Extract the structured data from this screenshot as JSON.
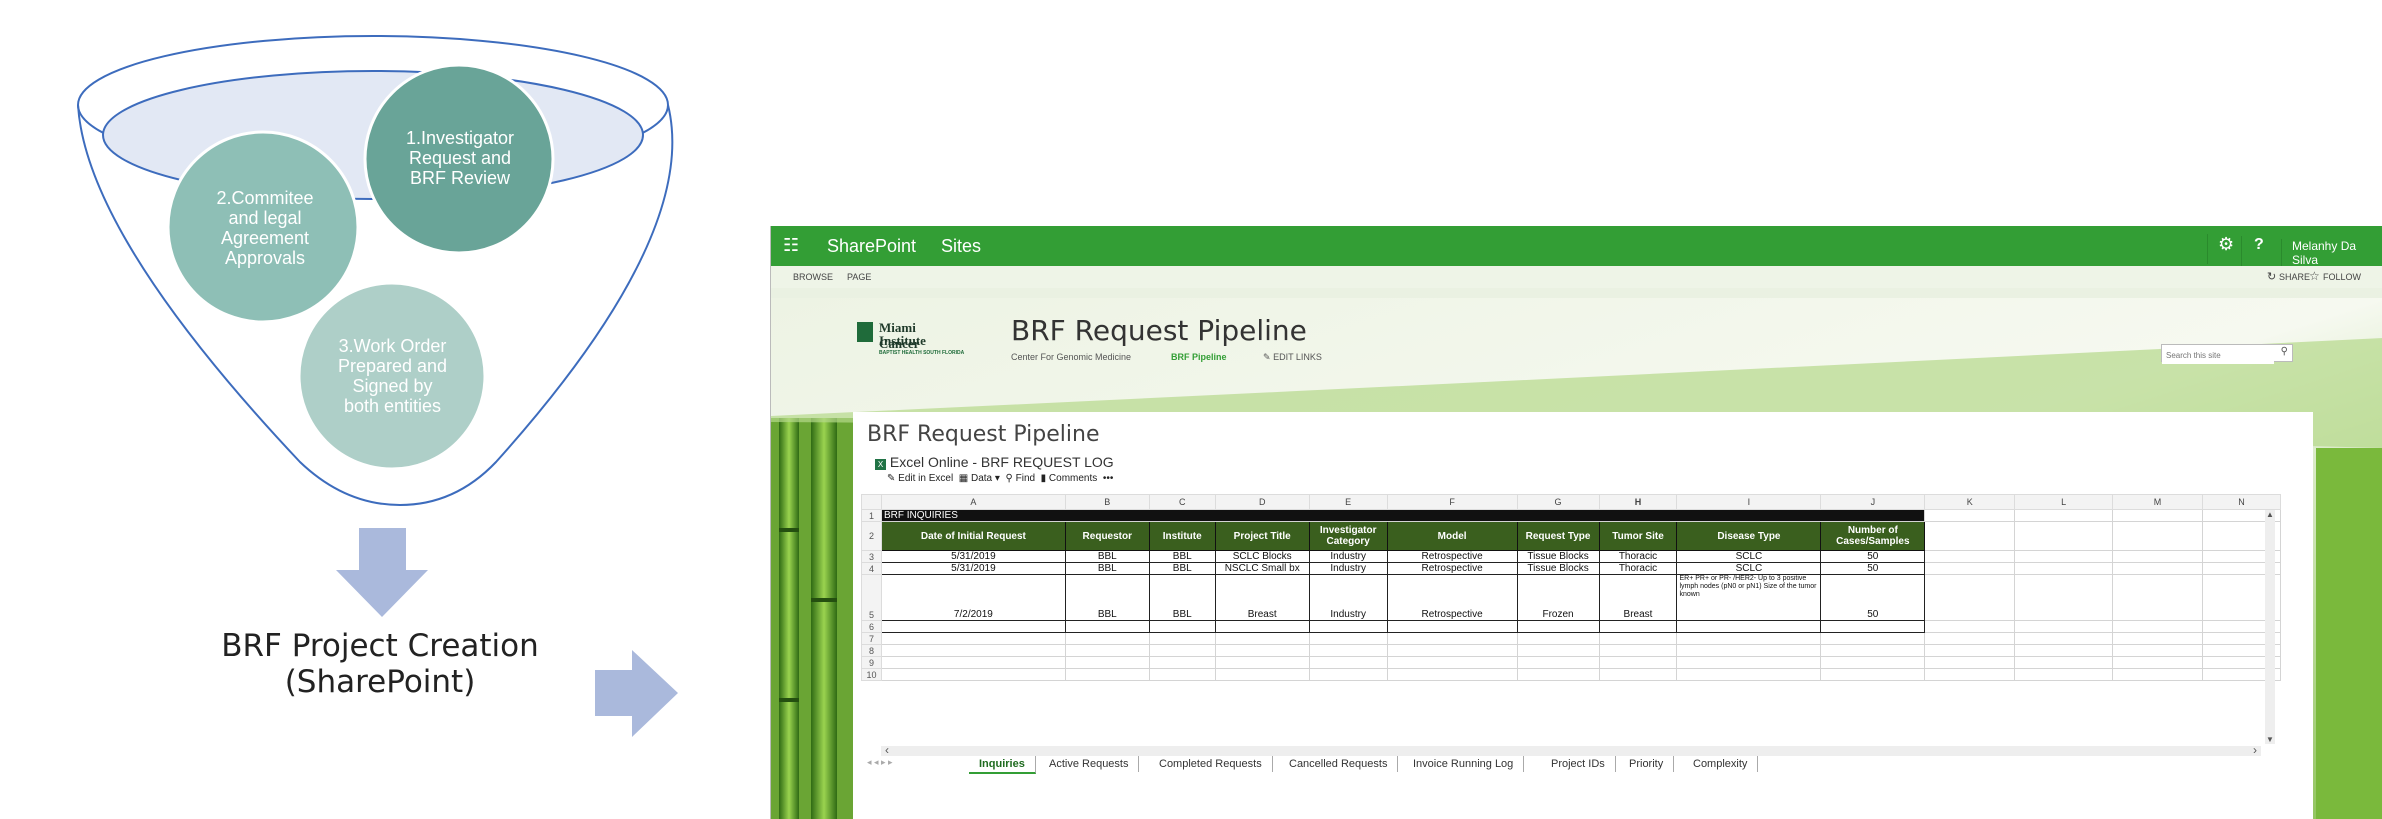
{
  "diagram": {
    "steps": [
      {
        "lines": [
          "1.Investigator",
          "Request and",
          "BRF Review"
        ]
      },
      {
        "lines": [
          "2.Commitee",
          "and legal",
          "Agreement",
          "Approvals"
        ]
      },
      {
        "lines": [
          "3.Work Order",
          "Prepared and",
          "Signed by",
          "both entities"
        ]
      }
    ],
    "creation_label_line1": "BRF Project Creation",
    "creation_label_line2": "(SharePoint)",
    "colors": {
      "step1": "#69a498",
      "step2": "#8ebfb6",
      "step3": "#aecfc8",
      "funnel": "#3d6cbd",
      "arrow": "#aab9dc"
    }
  },
  "sharepoint": {
    "suite_bar": {
      "app_name": "SharePoint",
      "sites_link": "Sites",
      "settings_icon": "gear-icon",
      "help_label": "?",
      "user_name": "Melanhy Da Silva",
      "color": "#339e35"
    },
    "ribbon": {
      "browse": "BROWSE",
      "page": "PAGE",
      "share": "SHARE",
      "follow": "FOLLOW"
    },
    "site_header": {
      "logo_line1": "Miami Cancer",
      "logo_line2": "Institute",
      "logo_tagline": "BAPTIST HEALTH SOUTH FLORIDA",
      "site_title": "BRF Request Pipeline",
      "nav": [
        "Center For Genomic Medicine",
        "BRF Pipeline"
      ],
      "edit_links": "EDIT LINKS",
      "search_placeholder": "Search this site"
    },
    "page_title": "BRF Request Pipeline",
    "webpart_title": "Excel Online - BRF REQUEST LOG",
    "excel_toolbar": {
      "edit_in_excel": "Edit in Excel",
      "data": "Data",
      "find": "Find",
      "comments": "Comments",
      "more": "•••"
    },
    "columns": [
      "A",
      "B",
      "C",
      "D",
      "E",
      "F",
      "G",
      "H",
      "I",
      "J",
      "K",
      "L",
      "M",
      "N"
    ],
    "selected_column": "H",
    "row_numbers": [
      "1",
      "2",
      "3",
      "4",
      "5",
      "6",
      "7",
      "8",
      "9",
      "10"
    ],
    "sheet_title": "BRF INQUIRIES",
    "headers": [
      "Date of Initial Request",
      "Requestor",
      "Institute",
      "Project Title",
      "Investigator Category",
      "Model",
      "Request Type",
      "Tumor Site",
      "Disease Type",
      "Number of Cases/Samples"
    ],
    "rows": [
      [
        "5/31/2019",
        "BBL",
        "BBL",
        "SCLC Blocks",
        "Industry",
        "Retrospective",
        "Tissue Blocks",
        "Thoracic",
        "SCLC",
        "50"
      ],
      [
        "5/31/2019",
        "BBL",
        "BBL",
        "NSCLC Small bx",
        "Industry",
        "Retrospective",
        "Tissue Blocks",
        "Thoracic",
        "SCLC",
        "50"
      ],
      [
        "7/2/2019",
        "BBL",
        "BBL",
        "Breast",
        "Industry",
        "Retrospective",
        "Frozen",
        "Breast",
        "ER+ PR+ or PR- /HER2-\nUp to 3 positive lymph nodes (pN0 or pN1)\nSize of the tumor known",
        "50"
      ]
    ],
    "sheet_tabs": [
      "Inquiries",
      "Active Requests",
      "Completed Requests",
      "Cancelled Requests",
      "Invoice Running Log",
      "Project IDs",
      "Priority",
      "Complexity"
    ],
    "active_tab": "Inquiries"
  }
}
